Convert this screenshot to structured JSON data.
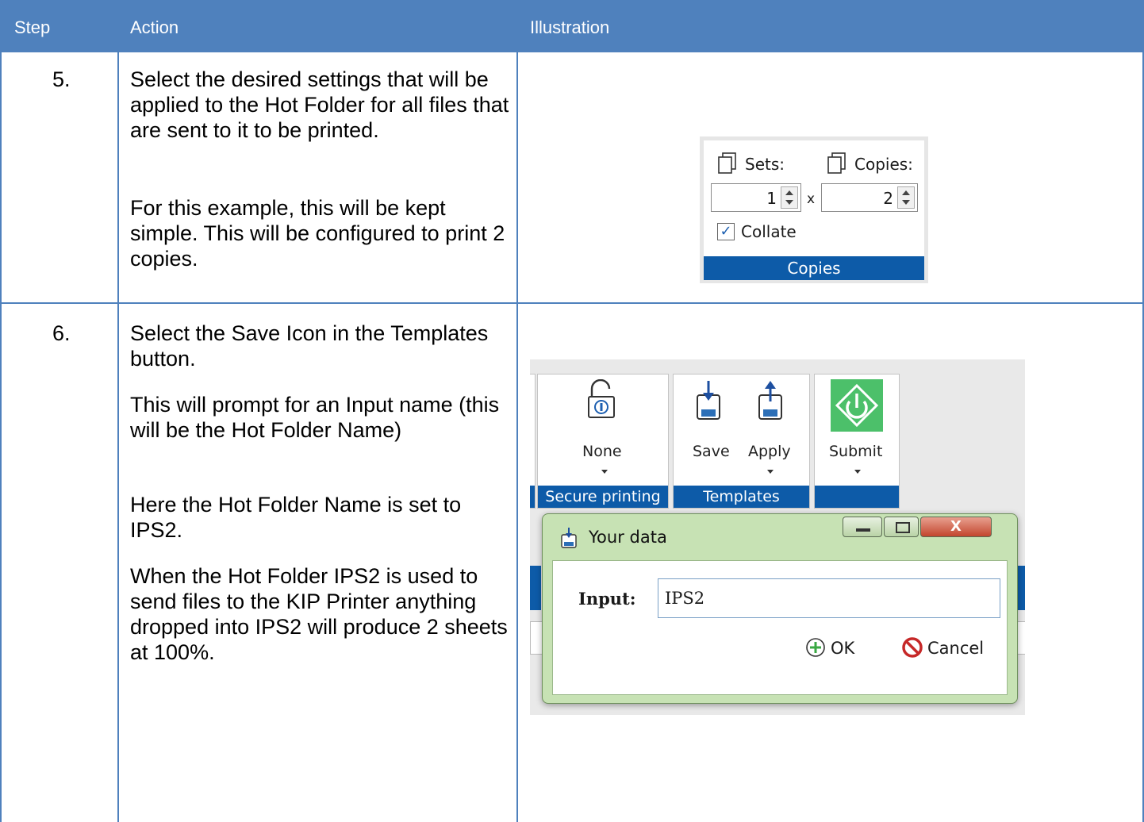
{
  "header": {
    "col_step": "Step",
    "col_action": "Action",
    "col_illustration": "Illustration"
  },
  "rows": [
    {
      "step": "5.",
      "paragraphs": [
        "Select the desired settings that will be applied to the Hot Folder for all files that are sent to it to be printed.",
        "For this example, this will be kept simple. This will be configured to print 2 copies."
      ]
    },
    {
      "step": "6.",
      "paragraphs": [
        "Select the Save Icon in the Templates button.",
        "This will prompt for an Input name (this will be the Hot Folder Name)",
        "Here the Hot Folder Name is set to IPS2.",
        "When the Hot Folder IPS2 is used to send files to the KIP Printer anything dropped into IPS2 will produce 2 sheets at 100%."
      ]
    }
  ],
  "copies_panel": {
    "sets_label": "Sets:",
    "copies_label": "Copies:",
    "sets_value": "1",
    "multiply_sign": "x",
    "copies_value": "2",
    "collate_label": "Collate",
    "collate_checked": true,
    "group_label": "Copies"
  },
  "ribbon": {
    "secure_button": "None",
    "secure_group": "Secure printing",
    "save_button": "Save",
    "apply_button": "Apply",
    "templates_group": "Templates",
    "submit_button": "Submit"
  },
  "dialog": {
    "title": "Your data",
    "close_glyph": "X",
    "input_label": "Input:",
    "input_value": "IPS2",
    "ok_label": "OK",
    "cancel_label": "Cancel"
  },
  "colors": {
    "header_blue": "#4f81bd",
    "ribbon_blue": "#0d5ba8",
    "dialog_green": "#c7e2b4",
    "submit_green": "#4cc06a"
  }
}
